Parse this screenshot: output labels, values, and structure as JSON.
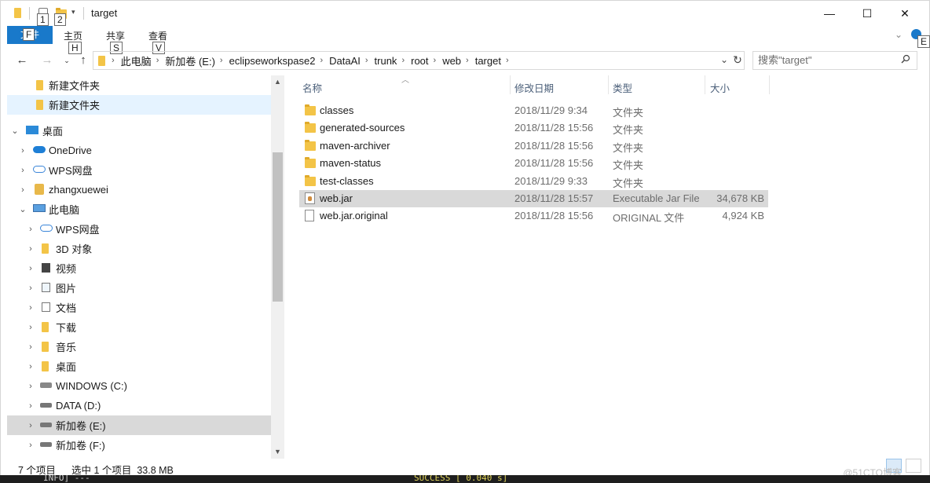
{
  "window": {
    "title": "target",
    "quick_access_keytips": [
      "1",
      "2"
    ],
    "controls": {
      "minimize": "—",
      "maximize": "☐",
      "close": "✕"
    }
  },
  "ribbon": {
    "file_tab": "文件",
    "file_keytip": "F",
    "tabs": [
      {
        "label": "主页",
        "keytip": "H"
      },
      {
        "label": "共享",
        "keytip": "S"
      },
      {
        "label": "查看",
        "keytip": "V"
      }
    ],
    "help_keytip": "E"
  },
  "address": {
    "crumbs": [
      "此电脑",
      "新加卷 (E:)",
      "eclipseworkspase2",
      "DataAI",
      "trunk",
      "root",
      "web",
      "target"
    ],
    "search_placeholder": "搜索\"target\""
  },
  "nav_tree": [
    {
      "label": "新建文件夹",
      "icon": "folder-icon",
      "level": 2,
      "selected": false
    },
    {
      "label": "新建文件夹",
      "icon": "folder-icon",
      "level": 2,
      "selected": true
    },
    {
      "label": "桌面",
      "icon": "desktop-icon",
      "level": 0,
      "expanded": true
    },
    {
      "label": "OneDrive",
      "icon": "onedrive-icon",
      "level": 1
    },
    {
      "label": "WPS网盘",
      "icon": "cloud-icon",
      "level": 1
    },
    {
      "label": "zhangxuewei",
      "icon": "user-icon",
      "level": 1
    },
    {
      "label": "此电脑",
      "icon": "computer-icon",
      "level": 1,
      "expanded": true
    },
    {
      "label": "WPS网盘",
      "icon": "cloud-icon",
      "level": 2
    },
    {
      "label": "3D 对象",
      "icon": "3d-objects-icon",
      "level": 2
    },
    {
      "label": "视频",
      "icon": "video-icon",
      "level": 2
    },
    {
      "label": "图片",
      "icon": "pictures-icon",
      "level": 2
    },
    {
      "label": "文档",
      "icon": "documents-icon",
      "level": 2
    },
    {
      "label": "下载",
      "icon": "downloads-icon",
      "level": 2
    },
    {
      "label": "音乐",
      "icon": "music-icon",
      "level": 2
    },
    {
      "label": "桌面",
      "icon": "desktop-folder-icon",
      "level": 2
    },
    {
      "label": "WINDOWS (C:)",
      "icon": "windows-drive-icon",
      "level": 2
    },
    {
      "label": "DATA (D:)",
      "icon": "drive-icon",
      "level": 2
    },
    {
      "label": "新加卷 (E:)",
      "icon": "drive-icon",
      "level": 2,
      "highlighted": true
    },
    {
      "label": "新加卷 (F:)",
      "icon": "drive-icon",
      "level": 2
    }
  ],
  "file_columns": {
    "name": "名称",
    "modified": "修改日期",
    "type": "类型",
    "size": "大小"
  },
  "files": [
    {
      "name": "classes",
      "modified": "2018/11/29 9:34",
      "type": "文件夹",
      "size": "",
      "icon": "folder-icon"
    },
    {
      "name": "generated-sources",
      "modified": "2018/11/28 15:56",
      "type": "文件夹",
      "size": "",
      "icon": "folder-icon"
    },
    {
      "name": "maven-archiver",
      "modified": "2018/11/28 15:56",
      "type": "文件夹",
      "size": "",
      "icon": "folder-icon"
    },
    {
      "name": "maven-status",
      "modified": "2018/11/28 15:56",
      "type": "文件夹",
      "size": "",
      "icon": "folder-icon"
    },
    {
      "name": "test-classes",
      "modified": "2018/11/29 9:33",
      "type": "文件夹",
      "size": "",
      "icon": "folder-icon"
    },
    {
      "name": "web.jar",
      "modified": "2018/11/28 15:57",
      "type": "Executable Jar File",
      "size": "34,678 KB",
      "icon": "jar-file-icon",
      "selected": true
    },
    {
      "name": "web.jar.original",
      "modified": "2018/11/28 15:56",
      "type": "ORIGINAL 文件",
      "size": "4,924 KB",
      "icon": "file-icon"
    }
  ],
  "status": {
    "count": "7 个项目",
    "selection": "选中 1 个项目  33.8 MB"
  },
  "background_console": {
    "left": "INFO] ---",
    "middle": "SUCCESS [  0.040 s]"
  },
  "watermark": "@51CTO博客"
}
